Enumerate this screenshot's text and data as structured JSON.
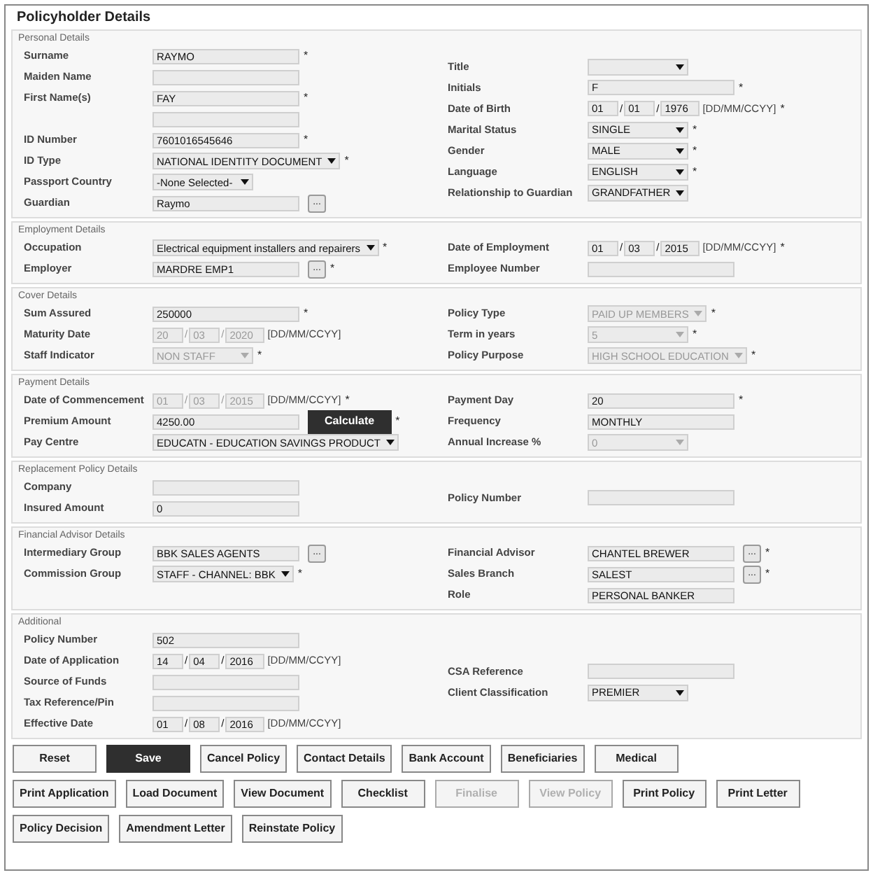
{
  "title": "Policyholder Details",
  "sections": [
    {
      "heading": "Personal Details",
      "left": [
        {
          "label": "Surname",
          "kind": "text",
          "value": "RAYMO",
          "marker": "*"
        },
        {
          "label": "Maiden Name",
          "kind": "text"
        },
        {
          "label": "First Name(s)",
          "kind": "text",
          "value": "FAY",
          "marker": "*"
        },
        {
          "kind": "text"
        },
        {
          "label": "ID Number",
          "kind": "text",
          "value": "7601016545646",
          "marker": "*"
        },
        {
          "label": "ID Type",
          "kind": "select",
          "value": "NATIONAL IDENTITY DOCUMENT",
          "marker": "*"
        },
        {
          "label": "Passport Country",
          "kind": "select",
          "value": "-None Selected-"
        },
        {
          "label": "Guardian",
          "kind": "lookup",
          "value": "Raymo",
          "button": {
            "label": "...",
            "primary": false
          }
        }
      ],
      "right": [
        {
          "label": "Title",
          "kind": "select"
        },
        {
          "label": "Initials",
          "kind": "text",
          "value": "F",
          "marker": "*"
        },
        {
          "label": "Date of Birth",
          "kind": "date",
          "parts": [
            "01",
            "01",
            "1976"
          ],
          "separator": "/",
          "format": "[DD/MM/CCYY]",
          "marker": "*"
        },
        {
          "label": "Marital Status",
          "kind": "select",
          "value": "SINGLE",
          "marker": "*"
        },
        {
          "label": "Gender",
          "kind": "select",
          "value": "MALE",
          "marker": "*"
        },
        {
          "label": "Language",
          "kind": "select",
          "value": "ENGLISH",
          "marker": "*"
        },
        {
          "label": "Relationship to Guardian",
          "kind": "select",
          "value": "GRANDFATHER"
        }
      ]
    },
    {
      "heading": "Employment Details",
      "left": [
        {
          "label": "Occupation",
          "kind": "select",
          "value": "Electrical equipment installers and repairers",
          "marker": "*"
        },
        {
          "label": "Employer",
          "kind": "lookup",
          "value": "MARDRE EMP1",
          "button": {
            "label": "...",
            "primary": false
          },
          "marker": "*"
        }
      ],
      "right": [
        {
          "label": "Date of Employment",
          "kind": "date",
          "parts": [
            "01",
            "03",
            "2015"
          ],
          "separator": "/",
          "format": "[DD/MM/CCYY]",
          "marker": "*"
        },
        {
          "label": "Employee Number",
          "kind": "text"
        }
      ]
    },
    {
      "heading": "Cover Details",
      "left": [
        {
          "label": "Sum Assured",
          "kind": "text",
          "value": "250000",
          "marker": "*"
        },
        {
          "label": "Maturity Date",
          "kind": "date",
          "parts": [
            "20",
            "03",
            "2020"
          ],
          "separator": "/",
          "format": "[DD/MM/CCYY]",
          "disabled": true
        },
        {
          "label": "Staff Indicator",
          "kind": "select",
          "value": "NON STAFF",
          "disabled": true,
          "marker": "*"
        }
      ],
      "right": [
        {
          "label": "Policy Type",
          "kind": "select",
          "value": "PAID UP MEMBERS",
          "disabled": true,
          "marker": "*"
        },
        {
          "label": "Term in years",
          "kind": "select",
          "value": "5",
          "disabled": true,
          "marker": "*"
        },
        {
          "label": "Policy Purpose",
          "kind": "select",
          "value": "HIGH SCHOOL EDUCATION",
          "disabled": true,
          "marker": "*"
        }
      ]
    },
    {
      "heading": "Payment Details",
      "left": [
        {
          "label": "Date of Commencement",
          "kind": "date",
          "parts": [
            "01",
            "03",
            "2015"
          ],
          "separator": "/",
          "format": "[DD/MM/CCYY]",
          "disabled": true,
          "marker": "*"
        },
        {
          "label": "Premium Amount",
          "kind": "lookup",
          "value": "4250.00",
          "button": {
            "label": "Calculate",
            "primary": true
          },
          "marker": "*"
        },
        {
          "label": "Pay Centre",
          "kind": "select",
          "value": "EDUCATN - EDUCATION SAVINGS PRODUCT"
        }
      ],
      "right": [
        {
          "label": "Payment Day",
          "kind": "text",
          "value": "20",
          "marker": "*"
        },
        {
          "label": "Frequency",
          "kind": "text",
          "value": "MONTHLY"
        },
        {
          "label": "Annual Increase %",
          "kind": "select",
          "value": "0",
          "disabled": true
        }
      ]
    },
    {
      "heading": "Replacement Policy Details",
      "left": [
        {
          "label": "Company",
          "kind": "text"
        },
        {
          "label": "Insured Amount",
          "kind": "text",
          "value": "0"
        }
      ],
      "right": [
        {
          "label": "Policy Number",
          "kind": "text"
        }
      ]
    },
    {
      "heading": "Financial Advisor Details",
      "left": [
        {
          "label": "Intermediary Group",
          "kind": "lookup",
          "value": "BBK SALES AGENTS",
          "button": {
            "label": "...",
            "primary": false
          }
        },
        {
          "label": "Commission Group",
          "kind": "select",
          "value": "STAFF - CHANNEL: BBK",
          "marker": "*"
        }
      ],
      "right": [
        {
          "label": "Financial Advisor",
          "kind": "lookup",
          "value": "CHANTEL BREWER",
          "button": {
            "label": "...",
            "primary": false
          },
          "marker": "*"
        },
        {
          "label": "Sales Branch",
          "kind": "lookup",
          "value": "SALEST",
          "button": {
            "label": "...",
            "primary": false
          },
          "marker": "*"
        },
        {
          "label": "Role",
          "kind": "text",
          "value": "PERSONAL BANKER"
        }
      ]
    },
    {
      "heading": "Additional",
      "left": [
        {
          "label": "Policy Number",
          "kind": "text",
          "value": "502"
        },
        {
          "label": "Date of Application",
          "kind": "date",
          "parts": [
            "14",
            "04",
            "2016"
          ],
          "separator": "/",
          "format": "[DD/MM/CCYY]"
        },
        {
          "label": "Source of Funds",
          "kind": "text"
        },
        {
          "label": "Tax Reference/Pin",
          "kind": "text"
        },
        {
          "label": "Effective Date",
          "kind": "date",
          "parts": [
            "01",
            "08",
            "2016"
          ],
          "separator": "/",
          "format": "[DD/MM/CCYY]"
        }
      ],
      "right": [
        {
          "label": "CSA Reference",
          "kind": "text"
        },
        {
          "label": "Client Classification",
          "kind": "select",
          "value": "PREMIER"
        }
      ]
    }
  ],
  "button_rows": [
    [
      {
        "label": "Reset",
        "primary": false,
        "disabled": false
      },
      {
        "label": "Save",
        "primary": true,
        "disabled": false
      },
      {
        "label": "Cancel Policy",
        "primary": false,
        "disabled": false
      },
      {
        "label": "Contact Details",
        "primary": false,
        "disabled": false
      },
      {
        "label": "Bank Account",
        "primary": false,
        "disabled": false
      },
      {
        "label": "Beneficiaries",
        "primary": false,
        "disabled": false
      },
      {
        "label": "Medical",
        "primary": false,
        "disabled": false
      }
    ],
    [
      {
        "label": "Print Application",
        "primary": false,
        "disabled": false
      },
      {
        "label": "Load Document",
        "primary": false,
        "disabled": false
      },
      {
        "label": "View Document",
        "primary": false,
        "disabled": false
      },
      {
        "label": "Checklist",
        "primary": false,
        "disabled": false
      },
      {
        "label": "Finalise",
        "primary": false,
        "disabled": true
      },
      {
        "label": "View Policy",
        "primary": false,
        "disabled": true
      },
      {
        "label": "Print Policy",
        "primary": false,
        "disabled": false
      },
      {
        "label": "Print Letter",
        "primary": false,
        "disabled": false
      }
    ],
    [
      {
        "label": "Policy Decision",
        "primary": false,
        "disabled": false
      },
      {
        "label": "Amendment Letter",
        "primary": false,
        "disabled": false
      },
      {
        "label": "Reinstate Policy",
        "primary": false,
        "disabled": false
      }
    ]
  ]
}
